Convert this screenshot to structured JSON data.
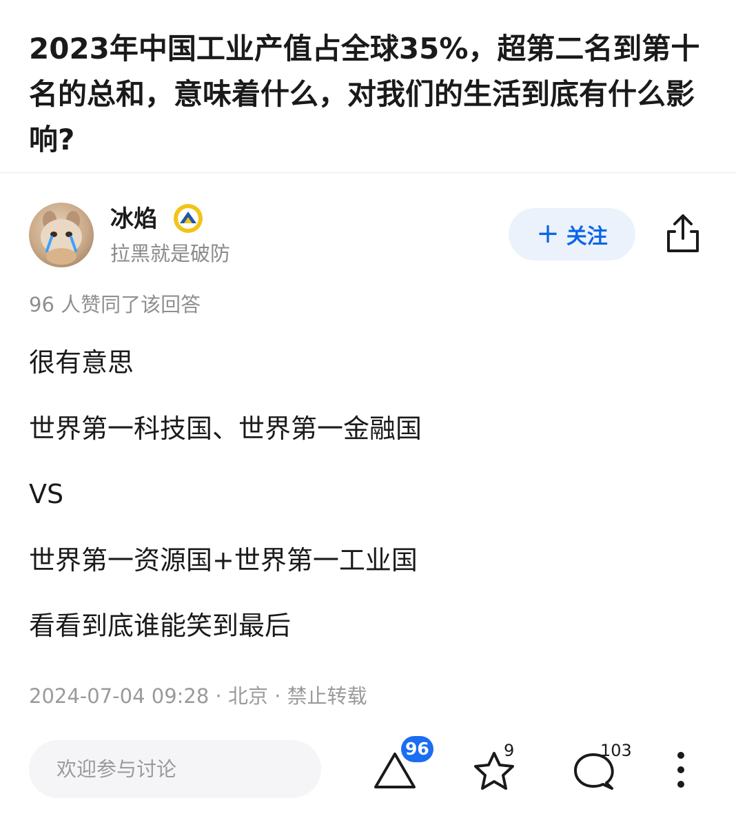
{
  "question": {
    "title": "2023年中国工业产值占全球35%，超第二名到第十名的总和，意味着什么，对我们的生活到底有什么影响?"
  },
  "author": {
    "name": "冰焰",
    "bio": "拉黑就是破防",
    "avatar_icon": "cat-avatar",
    "badge_icon": "verified-badge-icon"
  },
  "follow": {
    "plus": "+",
    "label": "关注"
  },
  "share_icon": "share-icon",
  "upvote_summary": "96 人赞同了该回答",
  "content": {
    "paragraphs": [
      "很有意思",
      "世界第一科技国、世界第一金融国",
      "VS",
      "世界第一资源国+世界第一工业国",
      "看看到底谁能笑到最后"
    ]
  },
  "meta": "2024-07-04 09:28 · 北京 · 禁止转载",
  "bottom_bar": {
    "comment_placeholder": "欢迎参与讨论",
    "upvote_count": "96",
    "favorite_count": "9",
    "comment_count": "103",
    "icons": [
      "upvote-triangle-icon",
      "star-icon",
      "comment-bubble-icon",
      "more-vertical-icon"
    ]
  },
  "colors": {
    "accent": "#1b6df2",
    "follow_bg": "#ebf2fc",
    "muted": "#8f8f8f"
  }
}
